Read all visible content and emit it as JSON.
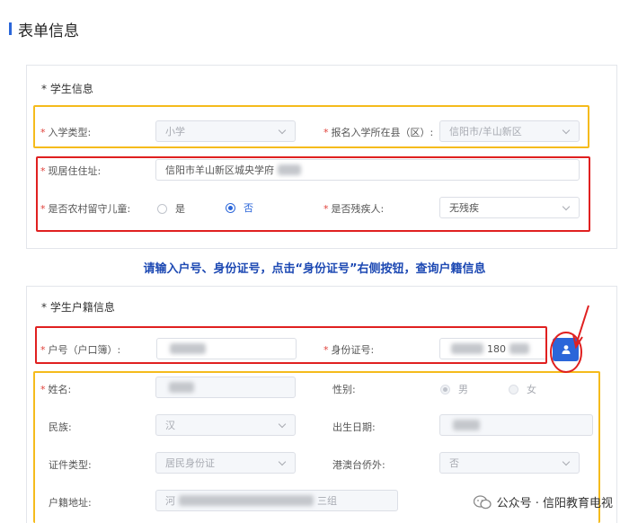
{
  "page": {
    "title": "表单信息"
  },
  "instruction": "请输入户号、身份证号，点击“身份证号”右侧按钮，查询户籍信息",
  "student_info": {
    "section_title": "* 学生信息",
    "enroll_type": {
      "label": "入学类型:",
      "value": "小学"
    },
    "county": {
      "label": "报名入学所在县（区）:",
      "value": "信阳市/羊山新区"
    },
    "address": {
      "label": "现居住住址:",
      "value": "信阳市羊山新区城央学府"
    },
    "left_behind": {
      "label": "是否农村留守儿童:",
      "options": [
        "是",
        "否"
      ],
      "selected": "否"
    },
    "disabled_person": {
      "label": "是否残疾人:",
      "value": "无残疾"
    }
  },
  "household_info": {
    "section_title": "* 学生户籍信息",
    "household_no": {
      "label": "户号（户口簿）:",
      "value": ""
    },
    "id_no": {
      "label": "身份证号:",
      "value": "180"
    },
    "name": {
      "label": "姓名:",
      "value": ""
    },
    "gender": {
      "label": "性别:",
      "options": [
        "男",
        "女"
      ],
      "selected": "男"
    },
    "ethnicity": {
      "label": "民族:",
      "value": "汉"
    },
    "birth_date": {
      "label": "出生日期:",
      "value": ""
    },
    "id_type": {
      "label": "证件类型:",
      "value": "居民身份证"
    },
    "hk_macau_tw": {
      "label": "港澳台侨外:",
      "value": "否"
    },
    "household_address": {
      "label": "户籍地址:",
      "value_start": "河",
      "value_end": "三组"
    }
  },
  "watermark": {
    "text": "公众号 · 信阳教育电视"
  },
  "colors": {
    "accent": "#2b66d9",
    "highlight_yellow": "#f5bb1c",
    "highlight_red": "#e02020",
    "instruction": "#1d49b3"
  }
}
